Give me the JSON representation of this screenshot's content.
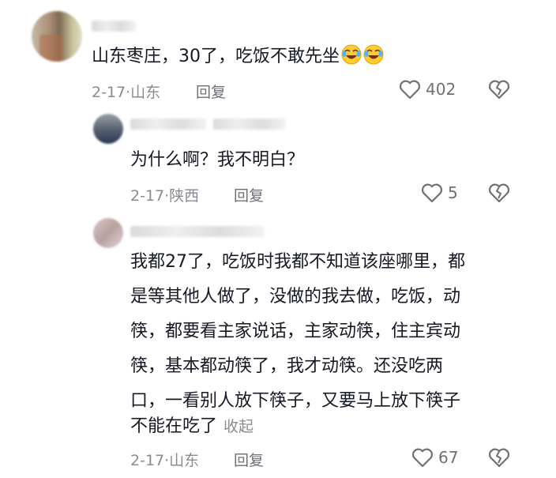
{
  "comments": [
    {
      "text": "山东枣庄，30了，吃饭不敢先坐",
      "emojis": [
        "laughing-crying-emoji",
        "laughing-crying-emoji"
      ],
      "date": "2-17",
      "location": "山东",
      "reply_label": "回复",
      "likes": "402"
    },
    {
      "text": "为什么啊？我不明白？",
      "date": "2-17",
      "location": "陕西",
      "reply_label": "回复",
      "likes": "5"
    },
    {
      "lines": [
        "我都27了，吃饭时我都不知道该座哪里，都",
        "是等其他人做了，没做的我去做，吃饭，动",
        "筷，都要看主家说话，主家动筷，住主宾动",
        "筷，基本都动筷了，我才动筷。还没吃两",
        "口，一看别人放下筷子，又要马上放下筷子",
        "不能在吃了"
      ],
      "collapse_label": "收起",
      "date": "2-17",
      "location": "山东",
      "reply_label": "回复",
      "likes": "67"
    }
  ],
  "meta_separator": "·",
  "icons": {
    "like": "heart-outline-icon",
    "dislike": "broken-heart-icon"
  },
  "colors": {
    "text": "#161823",
    "meta": "#8a8b91",
    "icon": "#6f7075"
  }
}
